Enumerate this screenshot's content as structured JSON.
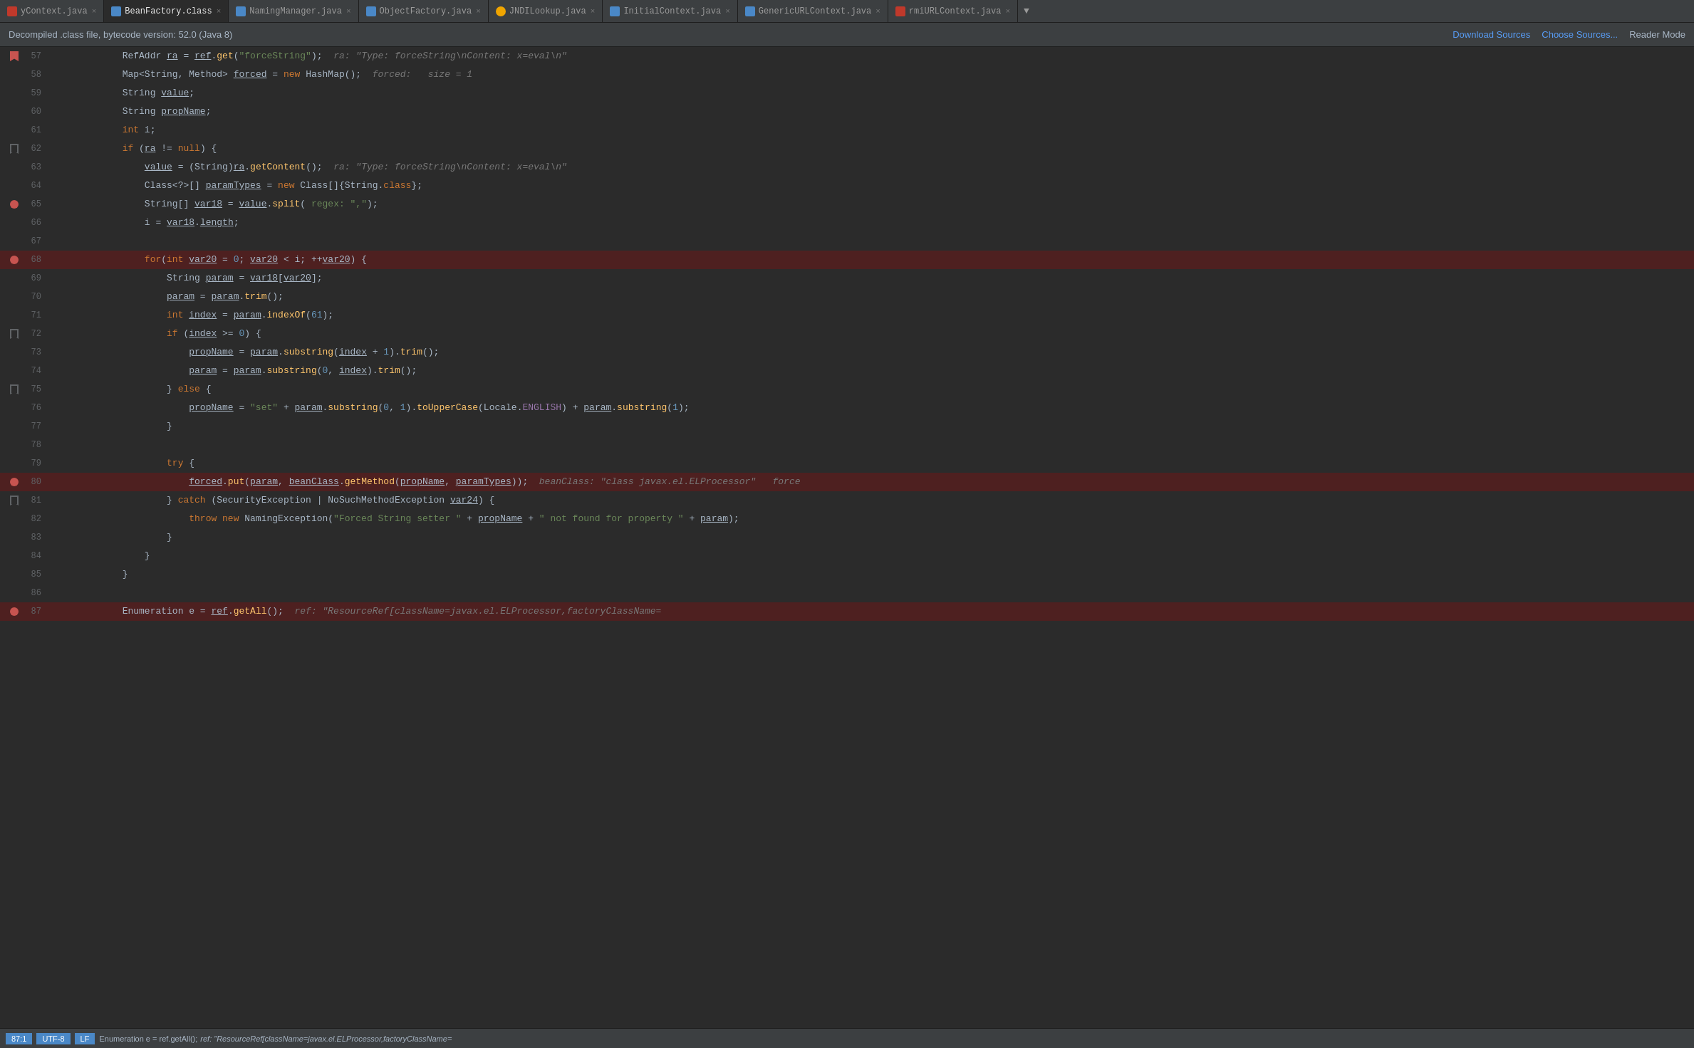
{
  "tabs": [
    {
      "label": "yContext.java",
      "active": false,
      "color": "#c0392b",
      "dot": true
    },
    {
      "label": "BeanFactory.class",
      "active": true,
      "color": "#4a88c7"
    },
    {
      "label": "NamingManager.java",
      "active": false,
      "color": "#4a88c7"
    },
    {
      "label": "ObjectFactory.java",
      "active": false,
      "color": "#4a88c7"
    },
    {
      "label": "JNDILookup.java",
      "active": false,
      "color": "#f0a500"
    },
    {
      "label": "InitialContext.java",
      "active": false,
      "color": "#4a88c7"
    },
    {
      "label": "GenericURLContext.java",
      "active": false,
      "color": "#4a88c7"
    },
    {
      "label": "rmiURLContext.java",
      "active": false,
      "color": "#c0392b",
      "dot": true
    }
  ],
  "info_bar": {
    "text": "Decompiled .class file, bytecode version: 52.0 (Java 8)",
    "download_sources": "Download Sources",
    "choose_sources": "Choose Sources...",
    "reader_mode": "Reader Mode"
  },
  "status_bar": {
    "text": "Enumeration e = ref.getAll();",
    "hint": "ref: \"ResourceRef[className=javax.el.ELProcessor,factoryClassName="
  },
  "lines": [
    {
      "num": 57,
      "breakpoint": false,
      "bookmark": "red",
      "indent": 3,
      "tokens": [
        {
          "t": "var",
          "v": "RefAddr "
        },
        {
          "t": "und var",
          "v": "ra"
        },
        {
          "t": "var",
          "v": " = "
        },
        {
          "t": "und var",
          "v": "ref"
        },
        {
          "t": "var",
          "v": "."
        },
        {
          "t": "fn",
          "v": "get"
        },
        {
          "t": "var",
          "v": "("
        },
        {
          "t": "str",
          "v": "\"forceString\""
        },
        {
          "t": "var",
          "v": ");"
        },
        {
          "t": "hint",
          "v": "  ra: \"Type: forceString\\nContent: x=eval\\n\""
        }
      ]
    },
    {
      "num": 58,
      "breakpoint": false,
      "bookmark": null,
      "indent": 3,
      "tokens": [
        {
          "t": "type",
          "v": "Map"
        },
        {
          "t": "var",
          "v": "<"
        },
        {
          "t": "type",
          "v": "String"
        },
        {
          "t": "var",
          "v": ", "
        },
        {
          "t": "type",
          "v": "Method"
        },
        {
          "t": "var",
          "v": "> "
        },
        {
          "t": "und var",
          "v": "forced"
        },
        {
          "t": "var",
          "v": " = "
        },
        {
          "t": "kw",
          "v": "new "
        },
        {
          "t": "type",
          "v": "HashMap"
        },
        {
          "t": "var",
          "v": "();"
        },
        {
          "t": "hint",
          "v": "  forced:   size = 1"
        }
      ]
    },
    {
      "num": 59,
      "breakpoint": false,
      "bookmark": null,
      "indent": 3,
      "tokens": [
        {
          "t": "type",
          "v": "String "
        },
        {
          "t": "und var",
          "v": "value"
        },
        {
          "t": "var",
          "v": ";"
        }
      ]
    },
    {
      "num": 60,
      "breakpoint": false,
      "bookmark": null,
      "indent": 3,
      "tokens": [
        {
          "t": "type",
          "v": "String "
        },
        {
          "t": "und var",
          "v": "propName"
        },
        {
          "t": "var",
          "v": ";"
        }
      ]
    },
    {
      "num": 61,
      "breakpoint": false,
      "bookmark": null,
      "indent": 3,
      "tokens": [
        {
          "t": "kw",
          "v": "int "
        },
        {
          "t": "var",
          "v": "i;"
        }
      ]
    },
    {
      "num": 62,
      "breakpoint": false,
      "bookmark": "outline",
      "indent": 3,
      "tokens": [
        {
          "t": "kw",
          "v": "if "
        },
        {
          "t": "var",
          "v": "("
        },
        {
          "t": "und var",
          "v": "ra"
        },
        {
          "t": "var",
          "v": " != "
        },
        {
          "t": "kw",
          "v": "null"
        },
        {
          "t": "var",
          "v": ") {"
        }
      ]
    },
    {
      "num": 63,
      "breakpoint": false,
      "bookmark": null,
      "indent": 4,
      "tokens": [
        {
          "t": "und var",
          "v": "value"
        },
        {
          "t": "var",
          "v": " = ("
        },
        {
          "t": "type",
          "v": "String"
        },
        {
          "t": "var",
          "v": ")"
        },
        {
          "t": "und var",
          "v": "ra"
        },
        {
          "t": "var",
          "v": "."
        },
        {
          "t": "fn",
          "v": "getContent"
        },
        {
          "t": "var",
          "v": "();"
        },
        {
          "t": "hint",
          "v": "  ra: \"Type: forceString\\nContent: x=eval\\n\""
        }
      ]
    },
    {
      "num": 64,
      "breakpoint": false,
      "bookmark": null,
      "indent": 4,
      "tokens": [
        {
          "t": "type",
          "v": "Class"
        },
        {
          "t": "var",
          "v": "<?>[] "
        },
        {
          "t": "und var",
          "v": "paramTypes"
        },
        {
          "t": "var",
          "v": " = "
        },
        {
          "t": "kw",
          "v": "new "
        },
        {
          "t": "type",
          "v": "Class"
        },
        {
          "t": "var",
          "v": "[]{"
        },
        {
          "t": "type",
          "v": "String"
        },
        {
          "t": "var",
          "v": "."
        },
        {
          "t": "kw",
          "v": "class"
        },
        {
          "t": "var",
          "v": "};"
        }
      ]
    },
    {
      "num": 65,
      "breakpoint": true,
      "bookmark": null,
      "indent": 4,
      "tokens": [
        {
          "t": "type",
          "v": "String"
        },
        {
          "t": "var",
          "v": "[] "
        },
        {
          "t": "und var",
          "v": "var18"
        },
        {
          "t": "var",
          "v": " = "
        },
        {
          "t": "und var",
          "v": "value"
        },
        {
          "t": "var",
          "v": "."
        },
        {
          "t": "fn",
          "v": "split"
        },
        {
          "t": "var",
          "v": "( "
        },
        {
          "t": "ann",
          "v": "regex: "
        },
        {
          "t": "str",
          "v": "\",\""
        },
        {
          "t": "var",
          "v": ");"
        }
      ]
    },
    {
      "num": 66,
      "breakpoint": false,
      "bookmark": null,
      "indent": 4,
      "tokens": [
        {
          "t": "var",
          "v": "i = "
        },
        {
          "t": "und var",
          "v": "var18"
        },
        {
          "t": "var",
          "v": "."
        },
        {
          "t": "und var",
          "v": "length"
        },
        {
          "t": "var",
          "v": ";"
        }
      ]
    },
    {
      "num": 67,
      "breakpoint": false,
      "bookmark": null,
      "indent": 0,
      "tokens": []
    },
    {
      "num": 68,
      "breakpoint": true,
      "bookmark": "red",
      "indent": 4,
      "tokens": [
        {
          "t": "kw",
          "v": "for"
        },
        {
          "t": "var",
          "v": "("
        },
        {
          "t": "kw",
          "v": "int "
        },
        {
          "t": "und var",
          "v": "var20"
        },
        {
          "t": "var",
          "v": " = "
        },
        {
          "t": "num",
          "v": "0"
        },
        {
          "t": "var",
          "v": "; "
        },
        {
          "t": "und var",
          "v": "var20"
        },
        {
          "t": "var",
          "v": " < i; ++"
        },
        {
          "t": "und var",
          "v": "var20"
        },
        {
          "t": "var",
          "v": ") {"
        }
      ],
      "highlight": "red"
    },
    {
      "num": 69,
      "breakpoint": false,
      "bookmark": null,
      "indent": 5,
      "tokens": [
        {
          "t": "type",
          "v": "String "
        },
        {
          "t": "und var",
          "v": "param"
        },
        {
          "t": "var",
          "v": " = "
        },
        {
          "t": "und var",
          "v": "var18"
        },
        {
          "t": "var",
          "v": "["
        },
        {
          "t": "und var",
          "v": "var20"
        },
        {
          "t": "var",
          "v": "];"
        }
      ]
    },
    {
      "num": 70,
      "breakpoint": false,
      "bookmark": null,
      "indent": 5,
      "tokens": [
        {
          "t": "und var",
          "v": "param"
        },
        {
          "t": "var",
          "v": " = "
        },
        {
          "t": "und var",
          "v": "param"
        },
        {
          "t": "var",
          "v": "."
        },
        {
          "t": "fn",
          "v": "trim"
        },
        {
          "t": "var",
          "v": "();"
        }
      ]
    },
    {
      "num": 71,
      "breakpoint": false,
      "bookmark": null,
      "indent": 5,
      "tokens": [
        {
          "t": "kw",
          "v": "int "
        },
        {
          "t": "und var",
          "v": "index"
        },
        {
          "t": "var",
          "v": " = "
        },
        {
          "t": "und var",
          "v": "param"
        },
        {
          "t": "var",
          "v": "."
        },
        {
          "t": "fn",
          "v": "indexOf"
        },
        {
          "t": "var",
          "v": "("
        },
        {
          "t": "num",
          "v": "61"
        },
        {
          "t": "var",
          "v": ");"
        }
      ]
    },
    {
      "num": 72,
      "breakpoint": false,
      "bookmark": "outline",
      "indent": 5,
      "tokens": [
        {
          "t": "kw",
          "v": "if "
        },
        {
          "t": "var",
          "v": "("
        },
        {
          "t": "und var",
          "v": "index"
        },
        {
          "t": "var",
          "v": " >= "
        },
        {
          "t": "num",
          "v": "0"
        },
        {
          "t": "var",
          "v": ") {"
        }
      ]
    },
    {
      "num": 73,
      "breakpoint": false,
      "bookmark": null,
      "indent": 6,
      "tokens": [
        {
          "t": "und var",
          "v": "propName"
        },
        {
          "t": "var",
          "v": " = "
        },
        {
          "t": "und var",
          "v": "param"
        },
        {
          "t": "var",
          "v": "."
        },
        {
          "t": "fn",
          "v": "substring"
        },
        {
          "t": "var",
          "v": "("
        },
        {
          "t": "und var",
          "v": "index"
        },
        {
          "t": "var",
          "v": " + "
        },
        {
          "t": "num",
          "v": "1"
        },
        {
          "t": "var",
          "v": ")."
        },
        {
          "t": "fn",
          "v": "trim"
        },
        {
          "t": "var",
          "v": "();"
        }
      ]
    },
    {
      "num": 74,
      "breakpoint": false,
      "bookmark": null,
      "indent": 6,
      "tokens": [
        {
          "t": "und var",
          "v": "param"
        },
        {
          "t": "var",
          "v": " = "
        },
        {
          "t": "und var",
          "v": "param"
        },
        {
          "t": "var",
          "v": "."
        },
        {
          "t": "fn",
          "v": "substring"
        },
        {
          "t": "var",
          "v": "("
        },
        {
          "t": "num",
          "v": "0"
        },
        {
          "t": "var",
          "v": ", "
        },
        {
          "t": "und var",
          "v": "index"
        },
        {
          "t": "var",
          "v": ")."
        },
        {
          "t": "fn",
          "v": "trim"
        },
        {
          "t": "var",
          "v": "();"
        }
      ]
    },
    {
      "num": 75,
      "breakpoint": false,
      "bookmark": "outline",
      "indent": 5,
      "tokens": [
        {
          "t": "var",
          "v": "} "
        },
        {
          "t": "kw",
          "v": "else "
        },
        {
          "t": "var",
          "v": "{"
        }
      ]
    },
    {
      "num": 76,
      "breakpoint": false,
      "bookmark": null,
      "indent": 6,
      "tokens": [
        {
          "t": "und var",
          "v": "propName"
        },
        {
          "t": "var",
          "v": " = "
        },
        {
          "t": "str",
          "v": "\"set\""
        },
        {
          "t": "var",
          "v": " + "
        },
        {
          "t": "und var",
          "v": "param"
        },
        {
          "t": "var",
          "v": "."
        },
        {
          "t": "fn",
          "v": "substring"
        },
        {
          "t": "var",
          "v": "("
        },
        {
          "t": "num",
          "v": "0"
        },
        {
          "t": "var",
          "v": ", "
        },
        {
          "t": "num",
          "v": "1"
        },
        {
          "t": "var",
          "v": ")."
        },
        {
          "t": "fn",
          "v": "toUpperCase"
        },
        {
          "t": "var",
          "v": "("
        },
        {
          "t": "type",
          "v": "Locale"
        },
        {
          "t": "var",
          "v": "."
        },
        {
          "t": "kw2",
          "v": "ENGLISH"
        },
        {
          "t": "var",
          "v": ") + "
        },
        {
          "t": "und var",
          "v": "param"
        },
        {
          "t": "var",
          "v": "."
        },
        {
          "t": "fn",
          "v": "substring"
        },
        {
          "t": "var",
          "v": "("
        },
        {
          "t": "num",
          "v": "1"
        },
        {
          "t": "var",
          "v": ");"
        }
      ]
    },
    {
      "num": 77,
      "breakpoint": false,
      "bookmark": null,
      "indent": 5,
      "tokens": [
        {
          "t": "var",
          "v": "}"
        }
      ]
    },
    {
      "num": 78,
      "breakpoint": false,
      "bookmark": null,
      "indent": 0,
      "tokens": []
    },
    {
      "num": 79,
      "breakpoint": false,
      "bookmark": null,
      "indent": 5,
      "tokens": [
        {
          "t": "kw",
          "v": "try"
        },
        {
          "t": "var",
          "v": " {"
        }
      ]
    },
    {
      "num": 80,
      "breakpoint": true,
      "bookmark": "red",
      "indent": 6,
      "tokens": [
        {
          "t": "und var",
          "v": "forced"
        },
        {
          "t": "var",
          "v": "."
        },
        {
          "t": "fn",
          "v": "put"
        },
        {
          "t": "var",
          "v": "("
        },
        {
          "t": "und var",
          "v": "param"
        },
        {
          "t": "var",
          "v": ", "
        },
        {
          "t": "und var",
          "v": "beanClass"
        },
        {
          "t": "var",
          "v": "."
        },
        {
          "t": "fn",
          "v": "getMethod"
        },
        {
          "t": "var",
          "v": "("
        },
        {
          "t": "und var",
          "v": "propName"
        },
        {
          "t": "var",
          "v": ", "
        },
        {
          "t": "und var",
          "v": "paramTypes"
        },
        {
          "t": "var",
          "v": "));"
        },
        {
          "t": "hint",
          "v": "  beanClass: \"class javax.el.ELProcessor\"   force"
        }
      ],
      "highlight": "red"
    },
    {
      "num": 81,
      "breakpoint": false,
      "bookmark": "outline",
      "indent": 5,
      "tokens": [
        {
          "t": "var",
          "v": "} "
        },
        {
          "t": "kw",
          "v": "catch "
        },
        {
          "t": "var",
          "v": "("
        },
        {
          "t": "type",
          "v": "SecurityException"
        },
        {
          "t": "var",
          "v": " | "
        },
        {
          "t": "type",
          "v": "NoSuchMethodException "
        },
        {
          "t": "und var",
          "v": "var24"
        },
        {
          "t": "var",
          "v": ") {"
        }
      ]
    },
    {
      "num": 82,
      "breakpoint": false,
      "bookmark": null,
      "indent": 6,
      "tokens": [
        {
          "t": "kw",
          "v": "throw "
        },
        {
          "t": "kw",
          "v": "new "
        },
        {
          "t": "type",
          "v": "NamingException"
        },
        {
          "t": "var",
          "v": "("
        },
        {
          "t": "str",
          "v": "\"Forced String setter \""
        },
        {
          "t": "var",
          "v": " + "
        },
        {
          "t": "und var",
          "v": "propName"
        },
        {
          "t": "var",
          "v": " + "
        },
        {
          "t": "str",
          "v": "\" not found for property \""
        },
        {
          "t": "var",
          "v": " + "
        },
        {
          "t": "und var",
          "v": "param"
        },
        {
          "t": "var",
          "v": ");"
        }
      ]
    },
    {
      "num": 83,
      "breakpoint": false,
      "bookmark": null,
      "indent": 5,
      "tokens": [
        {
          "t": "var",
          "v": "}"
        }
      ]
    },
    {
      "num": 84,
      "breakpoint": false,
      "bookmark": null,
      "indent": 4,
      "tokens": [
        {
          "t": "var",
          "v": "}"
        }
      ]
    },
    {
      "num": 85,
      "breakpoint": false,
      "bookmark": null,
      "indent": 3,
      "tokens": [
        {
          "t": "var",
          "v": "}"
        }
      ]
    },
    {
      "num": 86,
      "breakpoint": false,
      "bookmark": null,
      "indent": 0,
      "tokens": []
    },
    {
      "num": 87,
      "breakpoint": true,
      "bookmark": "red",
      "indent": 3,
      "tokens": [
        {
          "t": "type",
          "v": "Enumeration "
        },
        {
          "t": "var",
          "v": "e = "
        },
        {
          "t": "und var",
          "v": "ref"
        },
        {
          "t": "var",
          "v": "."
        },
        {
          "t": "fn",
          "v": "getAll"
        },
        {
          "t": "var",
          "v": "();"
        },
        {
          "t": "hint",
          "v": "  ref: \"ResourceRef[className=javax.el.ELProcessor,factoryClassName="
        }
      ],
      "highlight": "red"
    }
  ]
}
